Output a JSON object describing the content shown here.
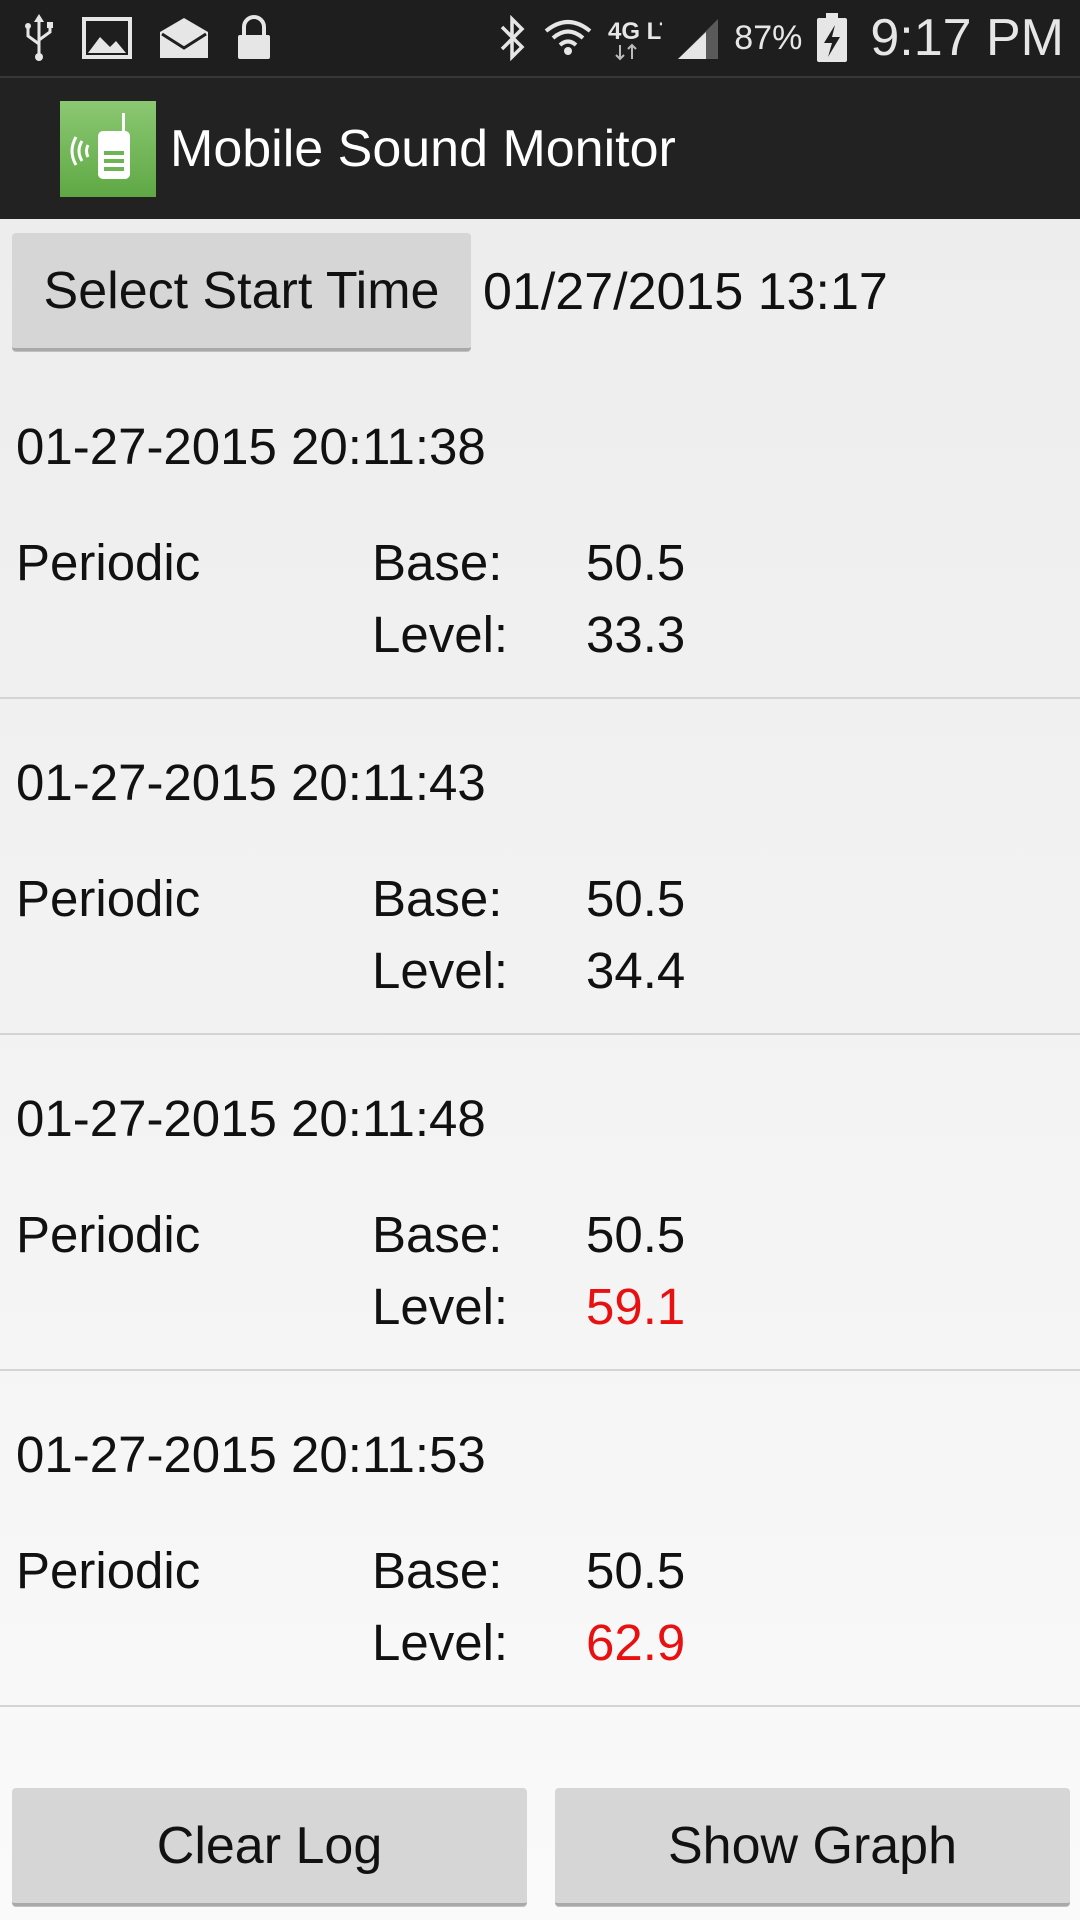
{
  "status_bar": {
    "battery": "87%",
    "time": "9:17 PM",
    "network": "4G LTE",
    "icons": [
      "usb-icon",
      "image-icon",
      "mail-icon",
      "lock-icon",
      "bluetooth-icon",
      "wifi-icon",
      "signal-icon",
      "battery-charging-icon"
    ]
  },
  "action_bar": {
    "title": "Mobile Sound Monitor",
    "icon": "sound-monitor-app-icon"
  },
  "start": {
    "button_label": "Select Start Time",
    "value": "01/27/2015 13:17"
  },
  "labels": {
    "base": "Base:",
    "level": "Level:"
  },
  "entries": [
    {
      "timestamp": "01-27-2015 20:11:38",
      "type": "Periodic",
      "base": "50.5",
      "level": "33.3",
      "alert": false
    },
    {
      "timestamp": "01-27-2015 20:11:43",
      "type": "Periodic",
      "base": "50.5",
      "level": "34.4",
      "alert": false
    },
    {
      "timestamp": "01-27-2015 20:11:48",
      "type": "Periodic",
      "base": "50.5",
      "level": "59.1",
      "alert": true
    },
    {
      "timestamp": "01-27-2015 20:11:53",
      "type": "Periodic",
      "base": "50.5",
      "level": "62.9",
      "alert": true
    }
  ],
  "colors": {
    "alert": "#e81010",
    "action_bar": "#222222",
    "status_bar": "#1e1e1e",
    "app_icon": "#6db455"
  },
  "bottom": {
    "clear_label": "Clear Log",
    "graph_label": "Show Graph"
  }
}
